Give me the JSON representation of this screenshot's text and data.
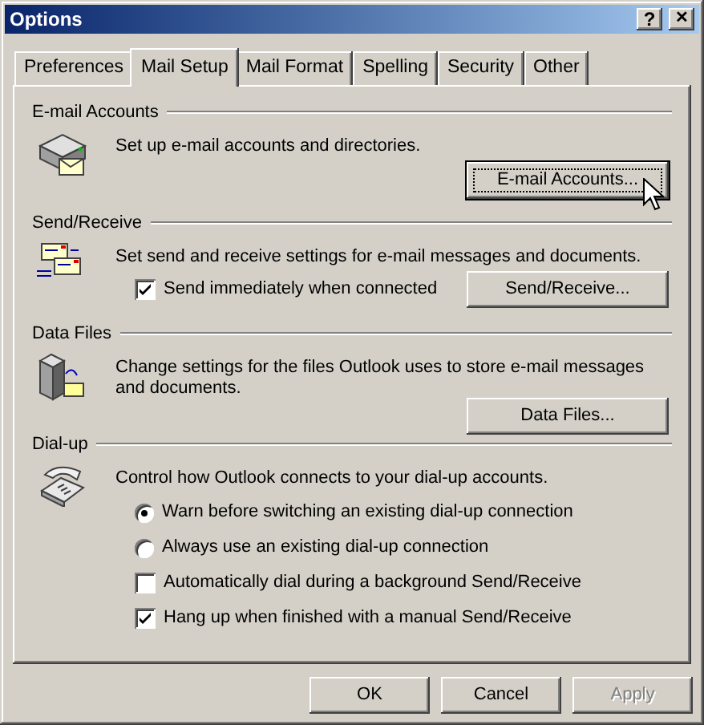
{
  "window": {
    "title": "Options",
    "title_buttons": [
      {
        "kind": "help",
        "label": "?"
      },
      {
        "kind": "close",
        "label": "✕"
      }
    ]
  },
  "tabs": [
    {
      "label": "Preferences",
      "selected": false
    },
    {
      "label": "Mail Setup",
      "selected": true
    },
    {
      "label": "Mail Format",
      "selected": false
    },
    {
      "label": "Spelling",
      "selected": false
    },
    {
      "label": "Security",
      "selected": false
    },
    {
      "label": "Other",
      "selected": false
    }
  ],
  "sections": [
    {
      "heading": "E-mail Accounts",
      "description": "Set up e-mail accounts and directories.",
      "button": {
        "label": "E-mail Accounts...",
        "focused": true
      }
    },
    {
      "heading": "Send/Receive",
      "description": "Set send and receive settings for e-mail messages and documents.",
      "options": [
        {
          "kind": "checkbox",
          "label": "Send immediately when connected",
          "checked": true
        }
      ],
      "button": {
        "label": "Send/Receive...",
        "focused": false
      }
    },
    {
      "heading": "Data Files",
      "description": "Change settings for the files Outlook uses to store e-mail messages and documents.",
      "button": {
        "label": "Data Files...",
        "focused": false
      }
    },
    {
      "heading": "Dial-up",
      "description": "Control how Outlook connects to your dial-up accounts.",
      "options": [
        {
          "kind": "radio",
          "label": "Warn before switching an existing dial-up connection",
          "selected": true
        },
        {
          "kind": "radio",
          "label": "Always use an existing dial-up connection",
          "selected": false
        },
        {
          "kind": "checkbox",
          "label": "Automatically dial during a background Send/Receive",
          "checked": false
        },
        {
          "kind": "checkbox",
          "label": "Hang up when finished with a manual Send/Receive",
          "checked": true
        }
      ]
    }
  ],
  "footer_buttons": [
    {
      "label": "OK",
      "disabled": false
    },
    {
      "label": "Cancel",
      "disabled": false
    },
    {
      "label": "Apply",
      "disabled": true
    }
  ]
}
